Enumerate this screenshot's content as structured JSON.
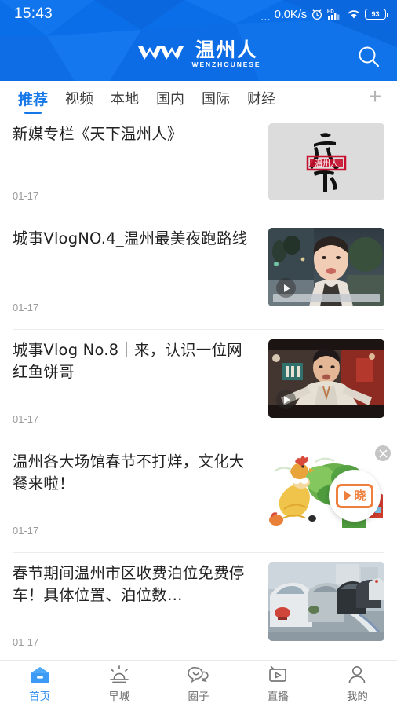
{
  "status_bar": {
    "time": "15:43",
    "dots": "...",
    "network_speed": "0.0K/s",
    "alarm_icon": "alarm-clock-icon",
    "hd_icon": "hd-signal-icon",
    "wifi_icon": "wifi-icon",
    "battery_level": "93"
  },
  "header": {
    "logo_cn": "温州人",
    "logo_en": "WENZHOUNESE",
    "search_icon": "search-icon",
    "background_color": "#0a6ee8"
  },
  "tabs": {
    "items": [
      {
        "label": "推荐",
        "active": true
      },
      {
        "label": "视频",
        "active": false
      },
      {
        "label": "本地",
        "active": false
      },
      {
        "label": "国内",
        "active": false
      },
      {
        "label": "国际",
        "active": false
      },
      {
        "label": "财经",
        "active": false
      }
    ],
    "add_label": "+",
    "active_color": "#1678e8"
  },
  "feed": {
    "articles": [
      {
        "title": "新媒专栏《天下温州人》",
        "date": "01-17",
        "thumb_type": "calligraphy",
        "thumb_alt": "天下温州人书法印章",
        "has_video": false
      },
      {
        "title": "城事VlogNO.4_温州最美夜跑路线",
        "date": "01-17",
        "thumb_type": "video-night-street",
        "thumb_alt": "夜晚街头人物视频",
        "has_video": true
      },
      {
        "title": "城事Vlog No.8｜来，认识一位网红鱼饼哥",
        "date": "01-17",
        "thumb_type": "video-market",
        "thumb_alt": "市场人物视频",
        "has_video": true
      },
      {
        "title": "温州各大场馆春节不打烊，文化大餐来啦！",
        "date": "01-17",
        "thumb_type": "farm-illustration",
        "thumb_alt": "农场插画",
        "has_video": false
      },
      {
        "title": "春节期间温州市区收费泊位免费停车！具体位置、泊位数…",
        "date": "01-17",
        "thumb_type": "parked-cars",
        "thumb_alt": "路边停放车辆",
        "has_video": false
      }
    ]
  },
  "floating_ad": {
    "logo_text": "晓",
    "logo_name": "baixiao-logo",
    "accent_color": "#ef7f3c",
    "close_icon": "close-icon"
  },
  "bottom_nav": {
    "items": [
      {
        "label": "首页",
        "icon": "home-icon",
        "active": true
      },
      {
        "label": "早城",
        "icon": "sunrise-icon",
        "active": false
      },
      {
        "label": "圈子",
        "icon": "chat-bubbles-icon",
        "active": false
      },
      {
        "label": "直播",
        "icon": "live-tv-icon",
        "active": false
      },
      {
        "label": "我的",
        "icon": "person-icon",
        "active": false
      }
    ],
    "active_color": "#2b8cf0"
  }
}
